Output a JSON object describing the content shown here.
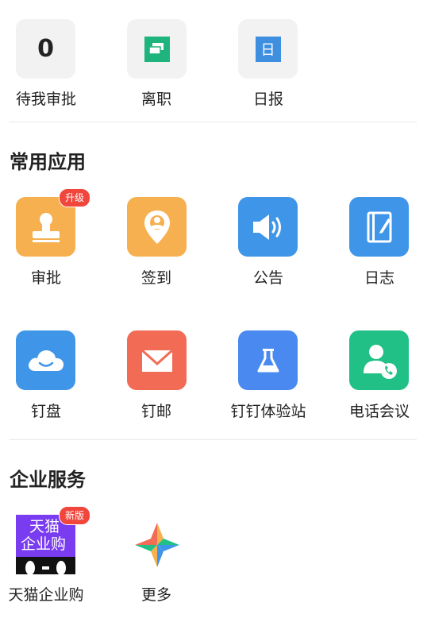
{
  "top_row": {
    "pending": {
      "count": "0",
      "label": "待我审批"
    },
    "resign": {
      "label": "离职"
    },
    "daily": {
      "icon_char": "日",
      "label": "日报"
    }
  },
  "common_apps": {
    "title": "常用应用",
    "approval": {
      "label": "审批",
      "badge": "升级",
      "color": "#f6b04f"
    },
    "checkin": {
      "label": "签到",
      "color": "#f6b04f"
    },
    "announcement": {
      "label": "公告",
      "color": "#3f96e8"
    },
    "log": {
      "label": "日志",
      "color": "#3f96e8"
    },
    "drive": {
      "label": "钉盘",
      "color": "#3f96e8"
    },
    "mail": {
      "label": "钉邮",
      "color": "#f26b55"
    },
    "lab": {
      "label": "钉钉体验站",
      "color": "#4a8af0"
    },
    "conference": {
      "label": "电话会议",
      "color": "#21c087"
    }
  },
  "enterprise": {
    "title": "企业服务",
    "tmall": {
      "label": "天猫企业购",
      "badge": "新版",
      "logo_line1": "天猫",
      "logo_line2": "企业购",
      "color": "#7a3cf0"
    },
    "more": {
      "label": "更多"
    }
  }
}
